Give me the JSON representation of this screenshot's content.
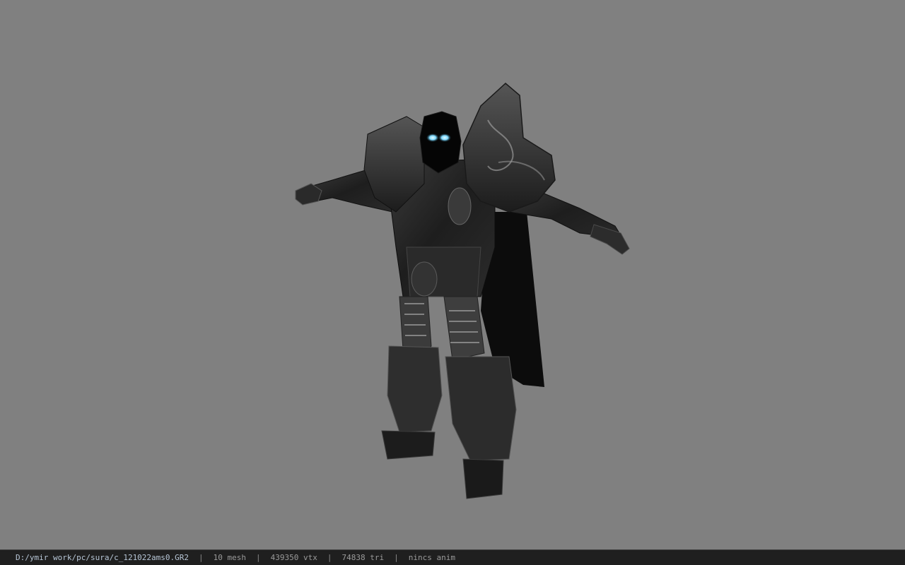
{
  "viewer": {
    "background_color": "#808080",
    "model_subject": "armored knight character model in T-pose",
    "eye_glow_color": "#7fd9ff"
  },
  "status": {
    "file_path": "D:/ymir work/pc/sura/c_121022ams0.GR2",
    "mesh_count": "10 mesh",
    "vertex_count": "439350 vtx",
    "triangle_count": "74838 tri",
    "anim_status": "nincs anim",
    "separator": "|"
  }
}
